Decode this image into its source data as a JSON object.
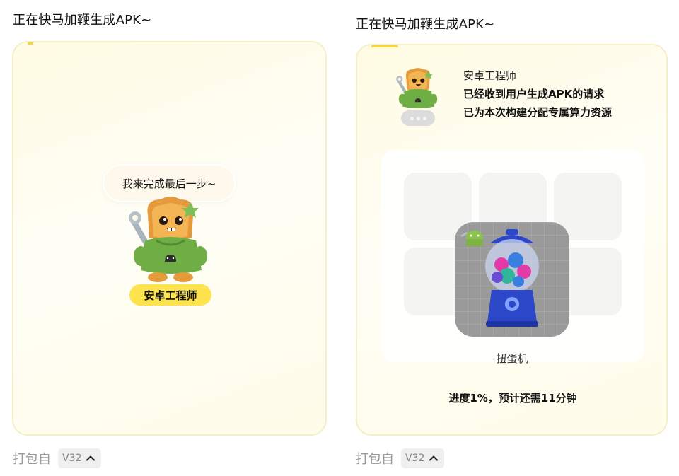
{
  "left_panel": {
    "title": "正在快马加鞭生成APK~",
    "bubble_text": "我来完成最后一步~",
    "role_name": "安卓工程师",
    "footer_label": "打包自",
    "version": "V32"
  },
  "right_panel": {
    "title": "正在快马加鞭生成APK~",
    "sender_name": "安卓工程师",
    "message_lines": [
      "已经收到用户生成APK的请求",
      "已为本次构建分配专属算力资源"
    ],
    "game_label": "扭蛋机",
    "progress_text": "进度1%，预计还需11分钟",
    "footer_label": "打包自",
    "version": "V32"
  },
  "colors": {
    "accent_yellow": "#fde34d",
    "card_border": "#f5efc8",
    "card_bg": "#fffbe3"
  },
  "icons": {
    "version_toggle": "chevron-up-icon",
    "mascot": "toast-engineer-mascot",
    "game": "gumball-machine-icon"
  }
}
